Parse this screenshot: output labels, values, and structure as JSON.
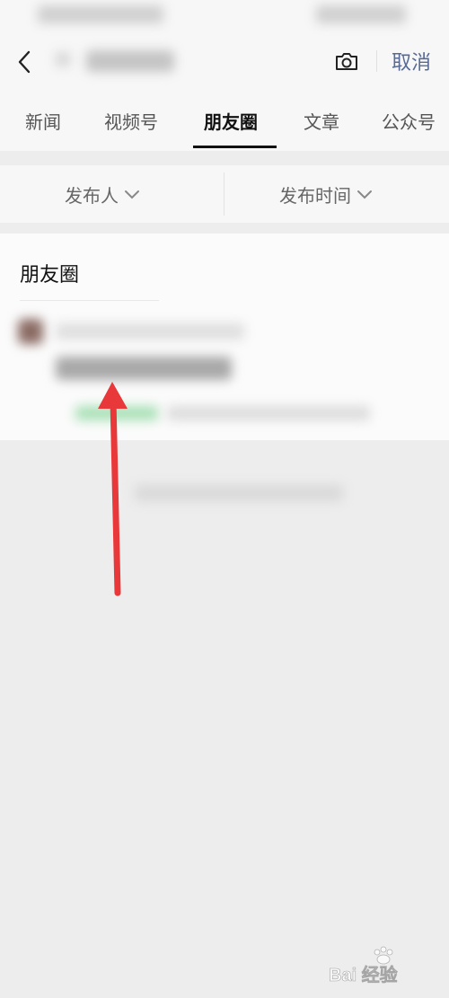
{
  "header": {
    "cancel_label": "取消"
  },
  "tabs": [
    {
      "label": "新闻",
      "active": false
    },
    {
      "label": "视频号",
      "active": false
    },
    {
      "label": "朋友圈",
      "active": true
    },
    {
      "label": "文章",
      "active": false
    },
    {
      "label": "公众号",
      "active": false
    }
  ],
  "filters": {
    "publisher_label": "发布人",
    "time_label": "发布时间"
  },
  "results": {
    "section_title": "朋友圈"
  },
  "watermark": {
    "text": "Bai 经验"
  },
  "colors": {
    "link": "#576b95",
    "annotation": "#e8383a",
    "tag_green": "#a8e0b6"
  },
  "icons": [
    "chevron-left-icon",
    "camera-icon",
    "chevron-down-icon",
    "annotation-arrow"
  ]
}
